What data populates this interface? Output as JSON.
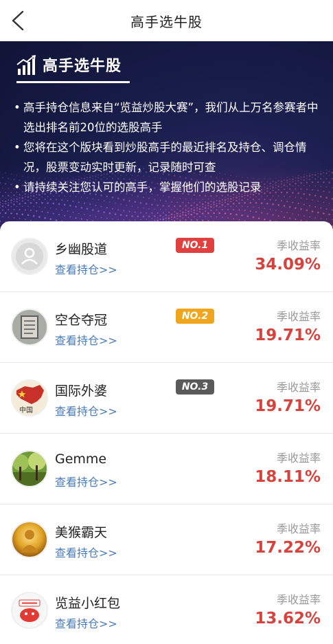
{
  "header": {
    "title": "高手选牛股",
    "back_icon": "chevron-left-icon"
  },
  "banner": {
    "title": "高手选牛股",
    "icon": "chart-bars-icon",
    "bullets": [
      "高手持仓信息来自“览益炒股大赛”，我们从上万名参赛者中选出排名前20位的选股高手",
      "您将在这个版块看到炒股高手的最近排名及持仓、调仓情况，股票变动实时更新，记录随时可查",
      "请持续关注您认可的高手，掌握他们的选股记录"
    ]
  },
  "list": {
    "link_label": "查看持仓>>",
    "rate_label": "季收益率",
    "rows": [
      {
        "name": "乡幽股道",
        "badge": "NO.1",
        "badge_color": "#e0413f",
        "rate": "34.09%",
        "avatar": "default-user-avatar"
      },
      {
        "name": "空仓夺冠",
        "badge": "NO.2",
        "badge_color": "#f0a51f",
        "rate": "19.71%",
        "avatar": "stone-tablet-avatar"
      },
      {
        "name": "国际外婆",
        "badge": "NO.3",
        "badge_color": "#5a5a5a",
        "rate": "19.71%",
        "avatar": "china-map-avatar"
      },
      {
        "name": "Gemme",
        "badge": "",
        "badge_color": "",
        "rate": "18.11%",
        "avatar": "forest-avatar"
      },
      {
        "name": "美猴霸天",
        "badge": "",
        "badge_color": "",
        "rate": "17.22%",
        "avatar": "golden-buddha-avatar"
      },
      {
        "name": "览益小红包",
        "badge": "",
        "badge_color": "",
        "rate": "13.62%",
        "avatar": "red-envelope-avatar"
      }
    ]
  },
  "colors": {
    "accent_red": "#d6423c",
    "link_blue": "#4a7bb7",
    "banner_bg": "#1a1f4e"
  }
}
